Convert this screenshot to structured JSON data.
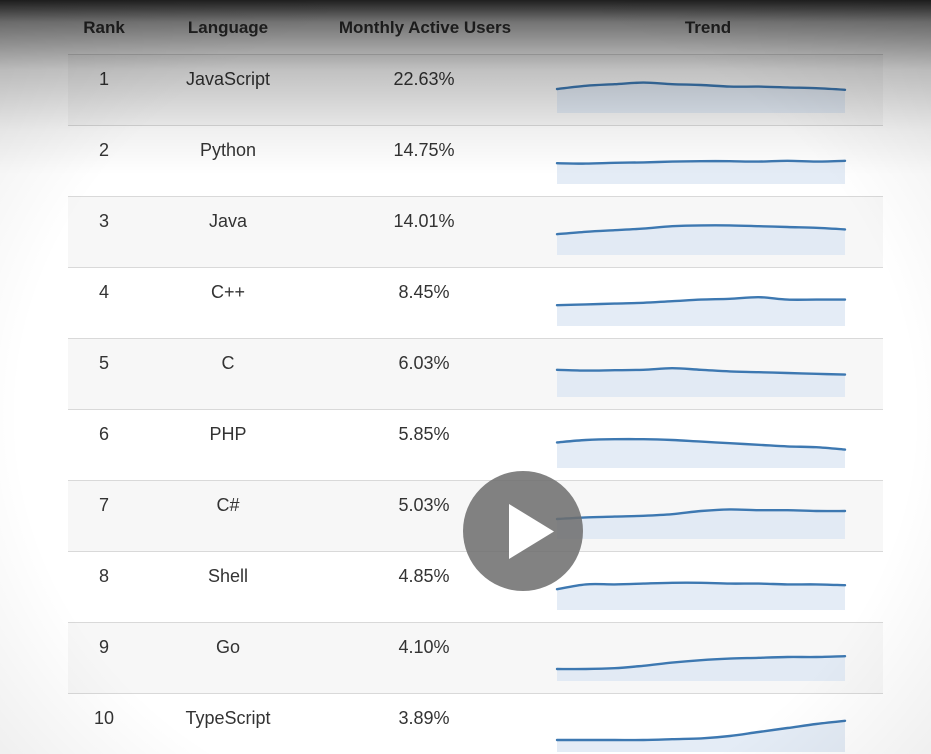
{
  "table": {
    "headers": {
      "rank": "Rank",
      "language": "Language",
      "mau": "Monthly Active Users",
      "trend": "Trend"
    },
    "rows": [
      {
        "rank": "1",
        "language": "JavaScript",
        "mau": "22.63%",
        "trend": [
          0.4,
          0.48,
          0.52,
          0.56,
          0.52,
          0.5,
          0.46,
          0.46,
          0.44,
          0.42,
          0.38
        ]
      },
      {
        "rank": "2",
        "language": "Python",
        "mau": "14.75%",
        "trend": [
          0.32,
          0.31,
          0.33,
          0.34,
          0.36,
          0.37,
          0.37,
          0.36,
          0.38,
          0.36,
          0.38
        ]
      },
      {
        "rank": "3",
        "language": "Java",
        "mau": "14.01%",
        "trend": [
          0.32,
          0.38,
          0.42,
          0.46,
          0.52,
          0.54,
          0.54,
          0.52,
          0.5,
          0.48,
          0.44
        ]
      },
      {
        "rank": "4",
        "language": "C++",
        "mau": "8.45%",
        "trend": [
          0.32,
          0.34,
          0.36,
          0.38,
          0.42,
          0.46,
          0.48,
          0.52,
          0.46,
          0.46,
          0.46
        ]
      },
      {
        "rank": "5",
        "language": "C",
        "mau": "6.03%",
        "trend": [
          0.48,
          0.46,
          0.47,
          0.48,
          0.52,
          0.48,
          0.44,
          0.42,
          0.4,
          0.38,
          0.36
        ]
      },
      {
        "rank": "6",
        "language": "PHP",
        "mau": "5.85%",
        "trend": [
          0.44,
          0.5,
          0.52,
          0.52,
          0.5,
          0.46,
          0.42,
          0.38,
          0.34,
          0.32,
          0.26
        ]
      },
      {
        "rank": "7",
        "language": "C#",
        "mau": "5.03%",
        "trend": [
          0.3,
          0.34,
          0.36,
          0.38,
          0.42,
          0.5,
          0.54,
          0.52,
          0.52,
          0.5,
          0.5
        ]
      },
      {
        "rank": "8",
        "language": "Shell",
        "mau": "4.85%",
        "trend": [
          0.32,
          0.44,
          0.44,
          0.46,
          0.48,
          0.48,
          0.46,
          0.46,
          0.44,
          0.44,
          0.42
        ]
      },
      {
        "rank": "9",
        "language": "Go",
        "mau": "4.10%",
        "trend": [
          0.1,
          0.1,
          0.12,
          0.18,
          0.26,
          0.32,
          0.36,
          0.38,
          0.4,
          0.4,
          0.42
        ]
      },
      {
        "rank": "10",
        "language": "TypeScript",
        "mau": "3.89%",
        "trend": [
          0.1,
          0.1,
          0.1,
          0.1,
          0.12,
          0.14,
          0.2,
          0.3,
          0.4,
          0.5,
          0.58
        ]
      }
    ]
  },
  "player": {
    "play_icon": "play-icon",
    "overlay_color": "#6e6e6e"
  },
  "colors": {
    "trend_line": "#3d78b1",
    "trend_fill": "#dbe6f3",
    "row_alt": "#f7f7f7"
  }
}
